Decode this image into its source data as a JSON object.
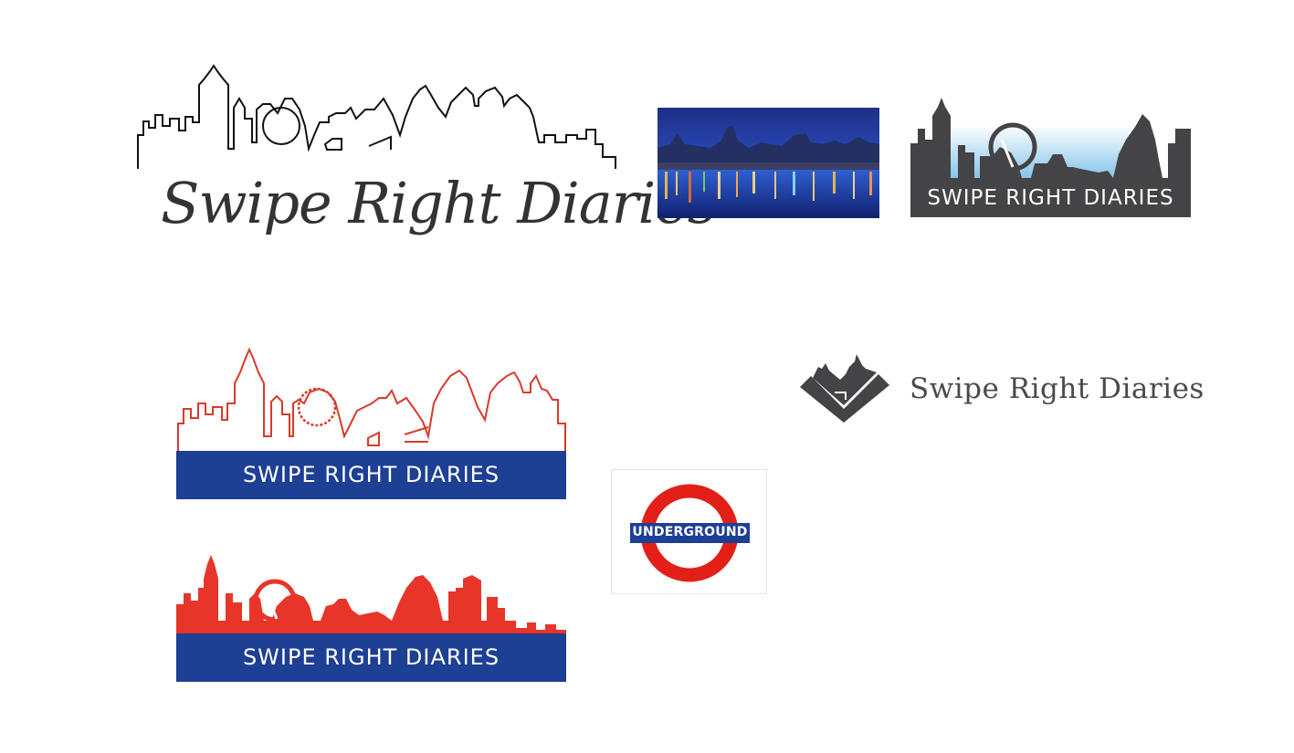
{
  "logos": {
    "script_logo": {
      "title": "Swipe Right Diaries"
    },
    "dark_logo": {
      "title": "SWIPE RIGHT DIARIES"
    },
    "red_outline_logo": {
      "title": "SWIPE RIGHT DIARIES"
    },
    "red_solid_logo": {
      "title": "SWIPE RIGHT DIARIES"
    },
    "icon_logo": {
      "title": "Swipe Right Diaries"
    }
  },
  "underground_sign": {
    "label": "UNDERGROUND"
  },
  "colors": {
    "ink": "#333333",
    "slate": "#4a4a4a",
    "red": "#e8352a",
    "outline_red": "#d93a2b",
    "blue": "#1d3f94",
    "roundel_red": "#e32017"
  }
}
